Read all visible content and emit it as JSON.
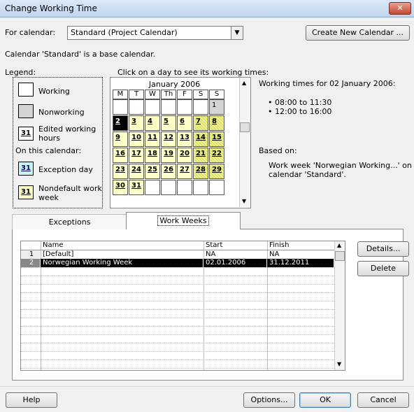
{
  "title": "Change Working Time",
  "close_label": "✕",
  "for_calendar_label": "For calendar:",
  "calendar_value": "Standard (Project Calendar)",
  "create_new_calendar": "Create New Calendar ...",
  "base_note": "Calendar 'Standard' is a base calendar.",
  "legend": {
    "title": "Legend:",
    "working": "Working",
    "nonworking": "Nonworking",
    "edited_line1": "Edited working",
    "edited_line2": "hours",
    "on_this_calendar": "On this calendar:",
    "exception_day": "Exception day",
    "nondefault_line1": "Nondefault work",
    "nondefault_line2": "week",
    "swatch_num": "31"
  },
  "calendar": {
    "instruction": "Click on a day to see its working times:",
    "month": "January 2006",
    "day_headers": [
      "M",
      "T",
      "W",
      "Th",
      "F",
      "S",
      "S"
    ],
    "weeks": [
      [
        "",
        "",
        "",
        "",
        "",
        "",
        "1"
      ],
      [
        "2",
        "3",
        "4",
        "5",
        "6",
        "7",
        "8"
      ],
      [
        "9",
        "10",
        "11",
        "12",
        "13",
        "14",
        "15"
      ],
      [
        "16",
        "17",
        "18",
        "19",
        "20",
        "21",
        "22"
      ],
      [
        "23",
        "24",
        "25",
        "26",
        "27",
        "28",
        "29"
      ],
      [
        "30",
        "31",
        "",
        "",
        "",
        "",
        ""
      ]
    ]
  },
  "working_times": {
    "heading": "Working times for 02 January 2006:",
    "times": [
      "• 08:00 to 11:30",
      "• 12:00 to 16:00"
    ],
    "based_on_label": "Based on:",
    "based_on_line1": "Work week 'Norwegian Working...' on",
    "based_on_line2": "calendar 'Standard'."
  },
  "tabs": [
    "Exceptions",
    "Work Weeks"
  ],
  "grid": {
    "headers": [
      "Name",
      "Start",
      "Finish"
    ],
    "rows": [
      {
        "num": "1",
        "name": "[Default]",
        "start": "NA",
        "finish": "NA"
      },
      {
        "num": "2",
        "name": "Norwegian Working Week",
        "start": "02.01.2006",
        "finish": "31.12.2011"
      }
    ]
  },
  "side_buttons": [
    "Details...",
    "Delete"
  ],
  "bottom": {
    "help": "Help",
    "options": "Options...",
    "ok": "OK",
    "cancel": "Cancel"
  }
}
